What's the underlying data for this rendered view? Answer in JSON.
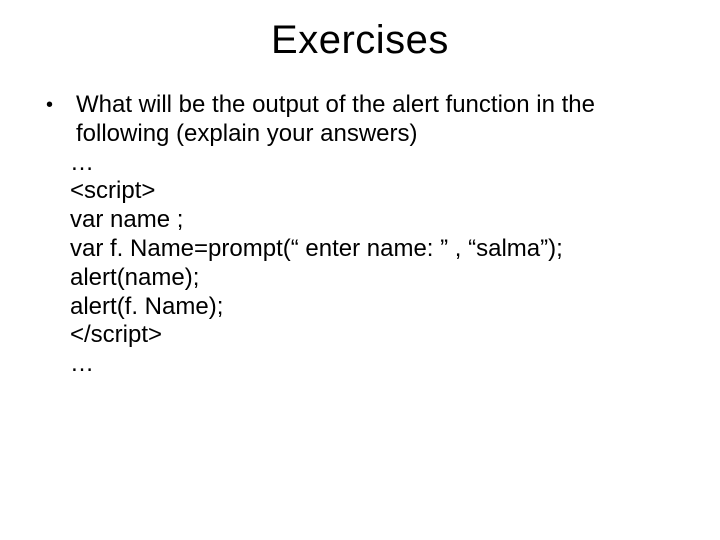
{
  "title": "Exercises",
  "bullet": {
    "dot": "•",
    "text": "What will be the output of the alert function in the following (explain your answers)"
  },
  "code": {
    "l1": "…",
    "l2": "<script>",
    "l3": "var name ;",
    "l4": "var f. Name=prompt(“ enter name: ” , “salma”);",
    "l5": "alert(name);",
    "l6": "alert(f. Name);",
    "l7": "</script>",
    "l8": "…"
  }
}
